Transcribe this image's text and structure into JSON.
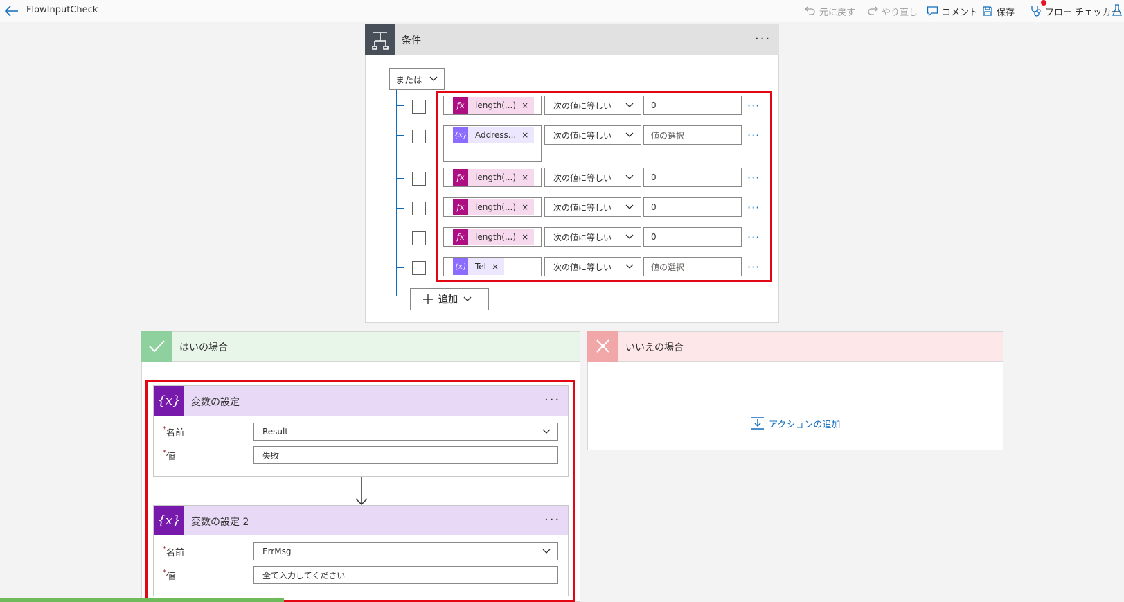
{
  "topbar": {
    "title": "FlowInputCheck",
    "undo": "元に戻す",
    "redo": "やり直し",
    "comment": "コメント",
    "save": "保存",
    "flow_checker": "フロー チェッカー"
  },
  "condition": {
    "title": "条件",
    "group_operator": "または",
    "add_label": "追加",
    "rows": [
      {
        "token": "length(...)",
        "token_type": "fx",
        "operator": "次の値に等しい",
        "value": "0"
      },
      {
        "token": "Address...",
        "token_type": "variable",
        "operator": "次の値に等しい",
        "value": "値の選択"
      },
      {
        "token": "length(...)",
        "token_type": "fx",
        "operator": "次の値に等しい",
        "value": "0"
      },
      {
        "token": "length(...)",
        "token_type": "fx",
        "operator": "次の値に等しい",
        "value": "0"
      },
      {
        "token": "length(...)",
        "token_type": "fx",
        "operator": "次の値に等しい",
        "value": "0"
      },
      {
        "token": "Tel",
        "token_type": "variable",
        "operator": "次の値に等しい",
        "value": "値の選択"
      }
    ]
  },
  "yes_branch": {
    "title": "はいの場合",
    "actions": [
      {
        "title": "変数の設定",
        "name_label": "名前",
        "name_value": "Result",
        "value_label": "値",
        "value": "失敗"
      },
      {
        "title": "変数の設定 2",
        "name_label": "名前",
        "name_value": "ErrMsg",
        "value_label": "値",
        "value": "全て入力してください"
      }
    ]
  },
  "no_branch": {
    "title": "いいえの場合",
    "add_action": "アクションの追加"
  },
  "colors": {
    "accent": "#0f6cbd",
    "highlight_border": "#e30613",
    "fx_token": "#ad0f83",
    "variable_token": "#8c6cff",
    "variable_card_icon": "#7719aa"
  }
}
